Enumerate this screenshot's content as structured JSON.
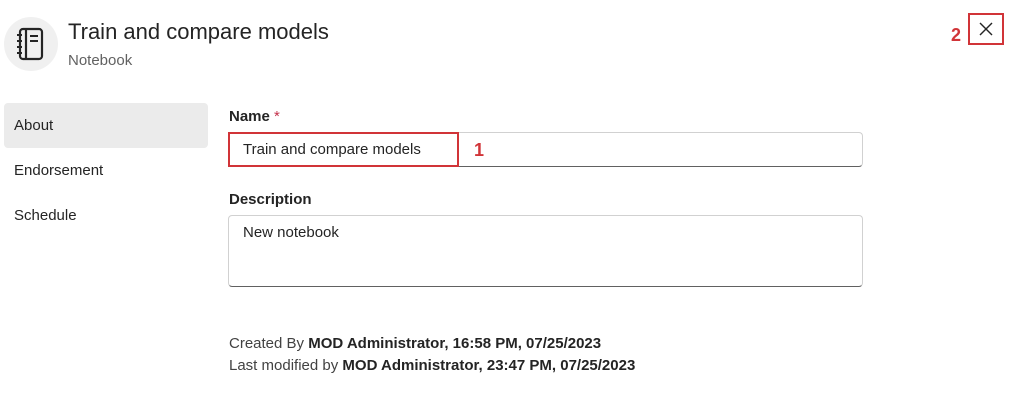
{
  "header": {
    "title": "Train and compare models",
    "subtitle": "Notebook",
    "icon": "notebook-icon",
    "close_icon": "close-icon"
  },
  "annotations": {
    "marker_1": "1",
    "marker_2": "2",
    "color": "#d13438"
  },
  "sidebar": {
    "items": [
      {
        "label": "About",
        "active": true
      },
      {
        "label": "Endorsement",
        "active": false
      },
      {
        "label": "Schedule",
        "active": false
      }
    ]
  },
  "form": {
    "name_label": "Name",
    "required_mark": "*",
    "name_value": "Train and compare models",
    "description_label": "Description",
    "description_value": "New notebook"
  },
  "meta": {
    "created_prefix": "Created By ",
    "created_value": "MOD Administrator, 16:58 PM, 07/25/2023",
    "modified_prefix": "Last modified by ",
    "modified_value": "MOD Administrator, 23:47 PM, 07/25/2023"
  }
}
